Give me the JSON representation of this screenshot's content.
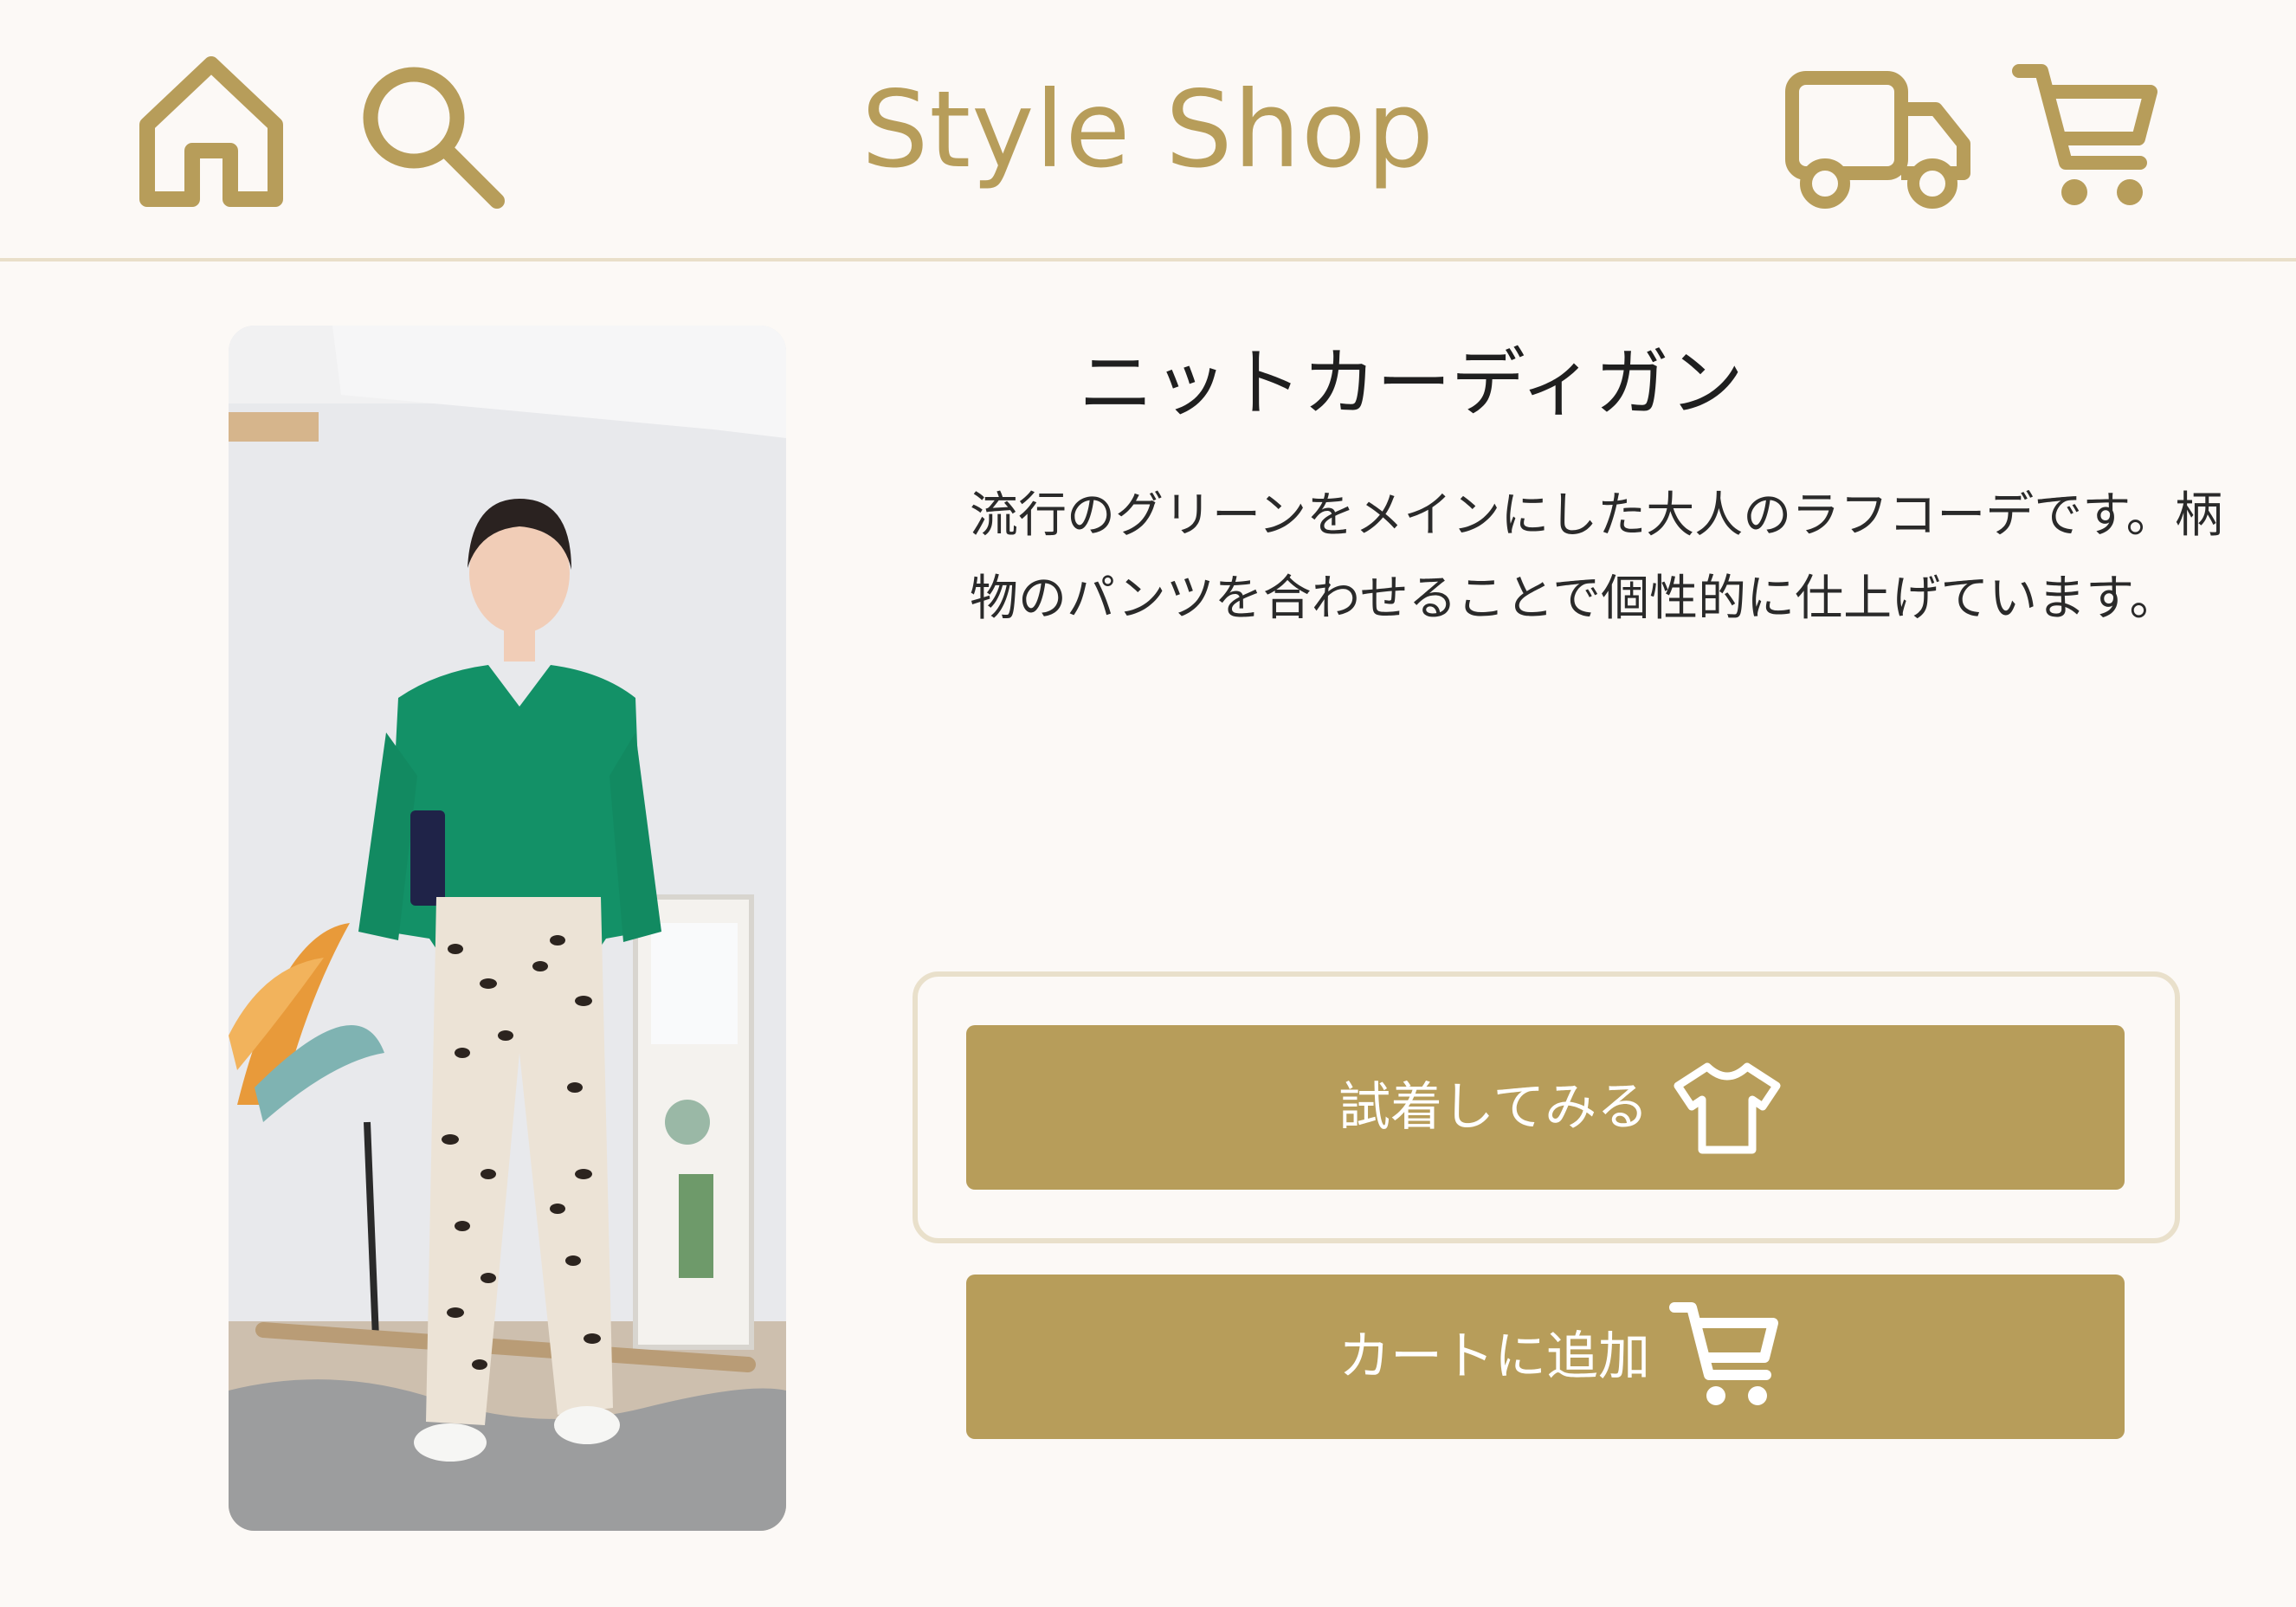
{
  "header": {
    "brand": "Style Shop",
    "icons": [
      "home-icon",
      "search-icon",
      "truck-icon",
      "cart-icon"
    ]
  },
  "product": {
    "title": "ニットカーディガン",
    "description": "流行のグリーンをメインにした大人のラフコーデです。柄物のパンツを合わせることで個性的に仕上げています。",
    "image_alt": "model wearing green knit cardigan and leopard print pants"
  },
  "actions": {
    "try_on_label": "試着してみる",
    "try_on_icon": "tshirt-icon",
    "add_to_cart_label": "カートに追加",
    "add_to_cart_icon": "cart-icon"
  },
  "colors": {
    "accent": "#b79d5a",
    "background": "#fcf9f6",
    "frame": "#e9e0cb",
    "divider": "#e9dfc9"
  }
}
